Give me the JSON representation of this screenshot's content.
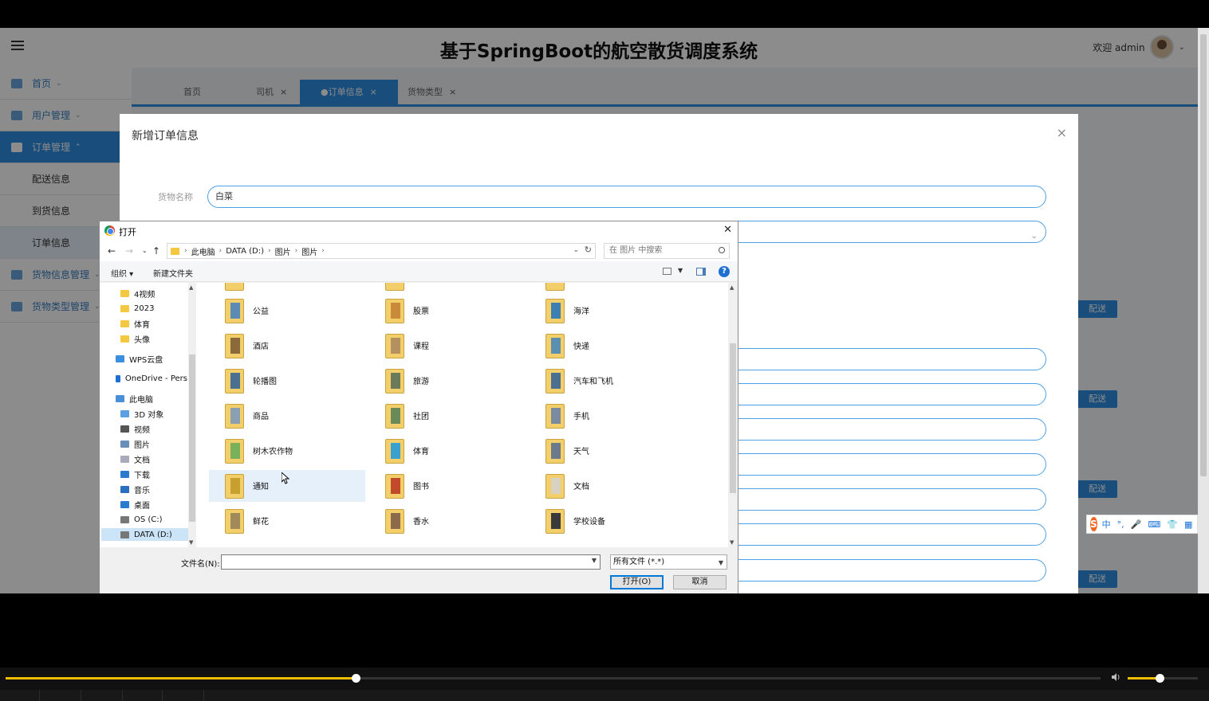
{
  "app": {
    "title": "基于SpringBoot的航空散货调度系统",
    "welcome": "欢迎 admin"
  },
  "sidebar": {
    "items": [
      {
        "label": "首页",
        "icon": "home-icon",
        "active": false
      },
      {
        "label": "用户管理",
        "icon": "user-icon",
        "active": false
      },
      {
        "label": "订单管理",
        "icon": "order-icon",
        "active": true
      },
      {
        "label": "货物信息管理",
        "icon": "goods-icon",
        "active": false
      },
      {
        "label": "货物类型管理",
        "icon": "type-icon",
        "active": false
      }
    ],
    "subitems": [
      {
        "label": "配送信息",
        "active": false
      },
      {
        "label": "到货信息",
        "active": false
      },
      {
        "label": "订单信息",
        "active": true
      }
    ]
  },
  "tabs": [
    {
      "label": "首页",
      "closable": false,
      "active": false
    },
    {
      "label": "司机",
      "closable": true,
      "active": false
    },
    {
      "label": "●订单信息",
      "closable": true,
      "active": true
    },
    {
      "label": "货物类型",
      "closable": true,
      "active": false
    }
  ],
  "table_actions": {
    "send_label": "配送"
  },
  "modal": {
    "title": "新增订单信息",
    "close": "×",
    "fields": [
      {
        "label": "货物名称",
        "value": "白菜"
      }
    ]
  },
  "dialog": {
    "title": "打开",
    "close": "✕",
    "breadcrumb": [
      "此电脑",
      "DATA (D:)",
      "图片",
      "图片"
    ],
    "search_placeholder": "在 图片 中搜索",
    "toolbar": {
      "organize": "组织 ▾",
      "new_folder": "新建文件夹"
    },
    "help": "?",
    "nav": [
      {
        "label": "4视频",
        "icon": "folder-icon",
        "indent": 1
      },
      {
        "label": "2023",
        "icon": "folder-icon",
        "indent": 1
      },
      {
        "label": "体育",
        "icon": "folder-icon",
        "indent": 1
      },
      {
        "label": "头像",
        "icon": "folder-icon",
        "indent": 1
      },
      {
        "label": "WPS云盘",
        "icon": "cloud-icon",
        "indent": 0
      },
      {
        "label": "OneDrive - Pers",
        "icon": "onedrive-icon",
        "indent": 0
      },
      {
        "label": "此电脑",
        "icon": "computer-icon",
        "indent": 0
      },
      {
        "label": "3D 对象",
        "icon": "3d-objects-icon",
        "indent": 1
      },
      {
        "label": "视频",
        "icon": "video-icon",
        "indent": 1
      },
      {
        "label": "图片",
        "icon": "pictures-icon",
        "indent": 1
      },
      {
        "label": "文档",
        "icon": "documents-icon",
        "indent": 1
      },
      {
        "label": "下载",
        "icon": "download-icon",
        "indent": 1
      },
      {
        "label": "音乐",
        "icon": "music-icon",
        "indent": 1
      },
      {
        "label": "桌面",
        "icon": "desktop-icon",
        "indent": 1
      },
      {
        "label": "OS (C:)",
        "icon": "drive-icon",
        "indent": 1
      },
      {
        "label": "DATA (D:)",
        "icon": "drive-icon",
        "indent": 1,
        "selected": true
      }
    ],
    "files": [
      [
        "公益",
        "股票",
        "海洋"
      ],
      [
        "酒店",
        "课程",
        "快递"
      ],
      [
        "轮播图",
        "旅游",
        "汽车和飞机"
      ],
      [
        "商品",
        "社团",
        "手机"
      ],
      [
        "树木农作物",
        "体育",
        "天气"
      ],
      [
        "通知",
        "图书",
        "文档"
      ],
      [
        "鲜花",
        "香水",
        "学校设备"
      ]
    ],
    "hovered_file": "通知",
    "filename_label": "文件名(N):",
    "filename_value": "",
    "filetype": "所有文件 (*.*)",
    "open_button": "打开(O)",
    "cancel_button": "取消"
  },
  "ime": {
    "labels": [
      "中",
      "°,",
      "🎤",
      "⌨",
      "👕",
      "▦"
    ]
  },
  "player": {
    "progress": 0.32,
    "volume": 0.45
  }
}
